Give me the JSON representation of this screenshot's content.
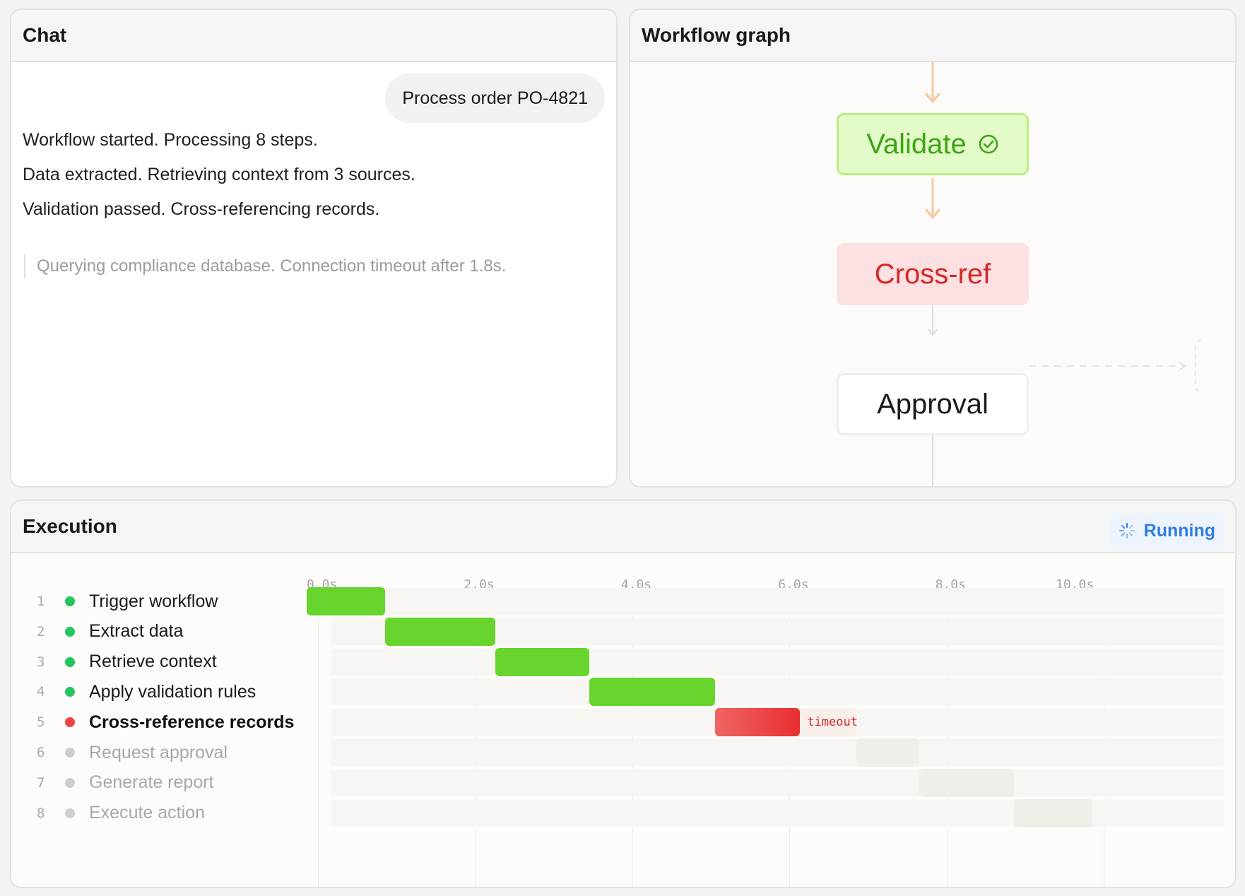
{
  "chat": {
    "title": "Chat",
    "user_message": "Process order PO-4821",
    "assistant_messages": [
      "Workflow started. Processing 8 steps.",
      "Data extracted. Retrieving context from 3 sources.",
      "Validation passed. Cross-referencing records."
    ],
    "streaming_message": "Querying compliance database. Connection timeout after 1.8s."
  },
  "graph": {
    "title": "Workflow graph",
    "nodes": [
      {
        "label": "Validate",
        "state": "done",
        "icon": "check-circle-icon"
      },
      {
        "label": "Cross-ref",
        "state": "error"
      },
      {
        "label": "Approval",
        "state": "pending"
      }
    ]
  },
  "execution": {
    "title": "Execution",
    "status": "Running",
    "status_icon": "spinner-icon",
    "ticks": [
      "0.0s",
      "2.0s",
      "4.0s",
      "6.0s",
      "8.0s",
      "10.0s"
    ],
    "steps": [
      {
        "num": "1",
        "label": "Trigger workflow",
        "state": "done",
        "start": 0.0,
        "end": 1.0
      },
      {
        "num": "2",
        "label": "Extract data",
        "state": "done",
        "start": 1.0,
        "end": 2.4
      },
      {
        "num": "3",
        "label": "Retrieve context",
        "state": "done",
        "start": 2.4,
        "end": 3.6
      },
      {
        "num": "4",
        "label": "Apply validation rules",
        "state": "done",
        "start": 3.6,
        "end": 5.2
      },
      {
        "num": "5",
        "label": "Cross-reference records",
        "state": "error",
        "start": 5.2,
        "end": 6.28,
        "tag": "timeout"
      },
      {
        "num": "6",
        "label": "Request approval",
        "state": "pending",
        "start": 7.0,
        "end": 7.8
      },
      {
        "num": "7",
        "label": "Generate report",
        "state": "pending",
        "start": 7.8,
        "end": 9.0
      },
      {
        "num": "8",
        "label": "Execute action",
        "state": "pending",
        "start": 9.0,
        "end": 10.0
      }
    ]
  },
  "colors": {
    "done": "#67d52d",
    "error": "#e82f2f",
    "pending": "#f1ede8",
    "accent": "#2f7de4",
    "edge_active": "#f5c89d"
  }
}
